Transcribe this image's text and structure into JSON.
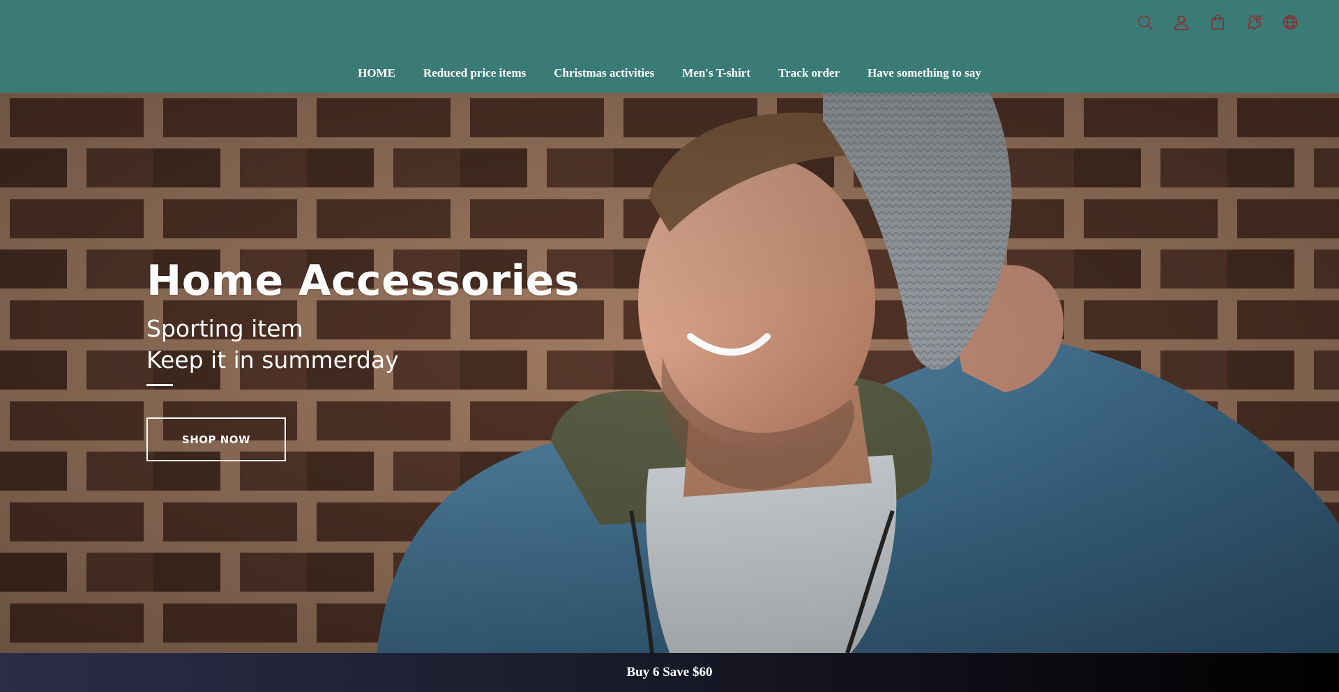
{
  "header": {
    "background": "#3b7b76",
    "icons": [
      {
        "name": "search-icon"
      },
      {
        "name": "user-icon"
      },
      {
        "name": "shopping-bag-icon"
      },
      {
        "name": "puzzle-icon"
      },
      {
        "name": "globe-icon"
      }
    ],
    "icon_color": "#8a2e2e"
  },
  "nav": {
    "items": [
      {
        "label": "HOME"
      },
      {
        "label": "Reduced price items"
      },
      {
        "label": "Christmas activities"
      },
      {
        "label": "Men's T-shirt"
      },
      {
        "label": "Track order"
      },
      {
        "label": "Have something to say"
      }
    ]
  },
  "hero": {
    "title": "Home Accessories",
    "subtitle_line1": "Sporting item",
    "subtitle_line2": "Keep it in summerday",
    "button_label": "SHOP NOW"
  },
  "promo": {
    "text": "Buy 6 Save $60"
  }
}
